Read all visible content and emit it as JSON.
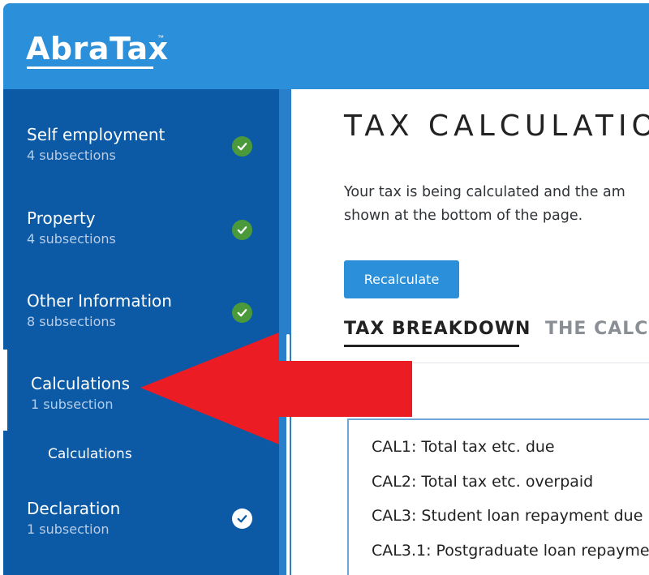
{
  "header": {
    "logo_text": "AbraTax",
    "logo_tm": "™"
  },
  "sidebar": {
    "items": [
      {
        "title": "Self employment",
        "subtitle": "4 subsections",
        "status": "complete"
      },
      {
        "title": "Property",
        "subtitle": "4 subsections",
        "status": "complete"
      },
      {
        "title": "Other Information",
        "subtitle": "8 subsections",
        "status": "complete"
      },
      {
        "title": "Calculations",
        "subtitle": "1 subsection",
        "status": "active"
      },
      {
        "title": "Declaration",
        "subtitle": "1 subsection",
        "status": "complete-white"
      }
    ],
    "sub_item": "Calculations"
  },
  "main": {
    "title": "TAX CALCULATION",
    "intro_line1": "Your tax is being calculated and the am",
    "intro_line2": "shown at the bottom of the page.",
    "recalculate_label": "Recalculate",
    "tabs": [
      {
        "label": "TAX BREAKDOWN",
        "active": true
      },
      {
        "label": "THE CALCU",
        "active": false
      }
    ],
    "breakdown_items": [
      "CAL1: Total tax etc. due",
      "CAL2: Total tax etc. overpaid",
      "CAL3: Student loan repayment due",
      "CAL3.1: Postgraduate loan repayme"
    ]
  },
  "colors": {
    "header_blue": "#2b8fd9",
    "sidebar_blue": "#0c5aa6",
    "check_green": "#4a9a3b",
    "arrow_red": "#ec1c24"
  },
  "icons": {
    "check": "check-circle-icon",
    "annotation": "red-arrow-left"
  }
}
